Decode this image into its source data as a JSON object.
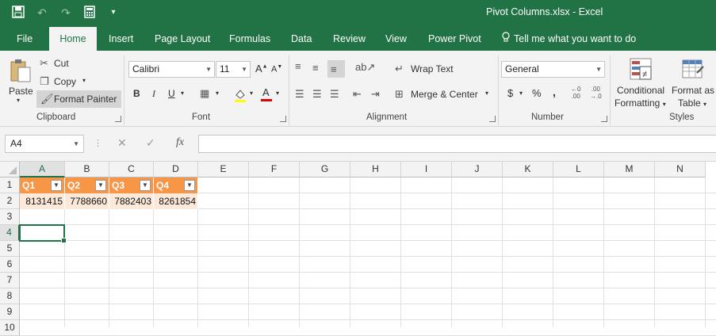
{
  "window": {
    "title": "Pivot Columns.xlsx - Excel"
  },
  "qat": {
    "icons": [
      "save-icon",
      "undo-icon",
      "redo-icon",
      "calculator-icon",
      "customize-icon"
    ]
  },
  "tabs": [
    {
      "label": "File"
    },
    {
      "label": "Home"
    },
    {
      "label": "Insert"
    },
    {
      "label": "Page Layout"
    },
    {
      "label": "Formulas"
    },
    {
      "label": "Data"
    },
    {
      "label": "Review"
    },
    {
      "label": "View"
    },
    {
      "label": "Power Pivot"
    },
    {
      "label": "Tell me what you want to do"
    }
  ],
  "clipboard": {
    "paste": "Paste",
    "cut": "Cut",
    "copy": "Copy",
    "format_painter": "Format Painter",
    "label": "Clipboard"
  },
  "font": {
    "name": "Calibri",
    "size": "11",
    "bold": "B",
    "italic": "I",
    "underline": "U",
    "label": "Font"
  },
  "alignment": {
    "wrap": "Wrap Text",
    "merge": "Merge & Center",
    "label": "Alignment"
  },
  "number": {
    "format": "General",
    "currency": "$",
    "percent": "%",
    "comma": ",",
    "label": "Number"
  },
  "styles": {
    "conditional1": "Conditional",
    "conditional2": "Formatting",
    "table1": "Format as",
    "table2": "Table",
    "label": "Styles"
  },
  "formula_bar": {
    "name_box": "A4",
    "fx": "fx",
    "cancel": "✕",
    "enter": "✓",
    "value": ""
  },
  "grid": {
    "columns": [
      "A",
      "B",
      "C",
      "D",
      "E",
      "F",
      "G",
      "H",
      "I",
      "J",
      "K",
      "L",
      "M",
      "N"
    ],
    "rows": [
      "1",
      "2",
      "3",
      "4",
      "5",
      "6",
      "7",
      "8",
      "9",
      "10"
    ],
    "selected_cell": "A4",
    "header_row": [
      "Q1",
      "Q2",
      "Q3",
      "Q4"
    ],
    "data_row": [
      "8131415",
      "7788660",
      "7882403",
      "8261854"
    ]
  },
  "colors": {
    "excel_green": "#217346",
    "table_header": "#f79646",
    "table_row": "#fde9d9"
  }
}
